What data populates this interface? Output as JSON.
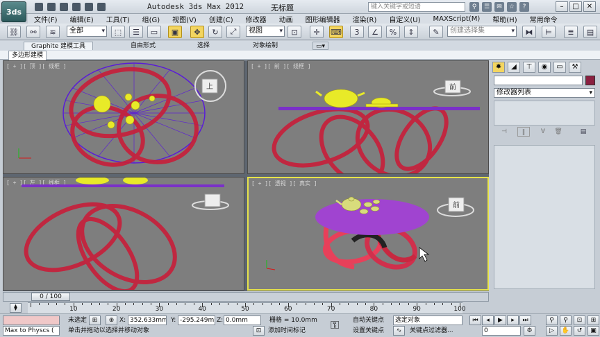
{
  "app": {
    "logo": "3ds",
    "title": "Autodesk 3ds Max  2012",
    "document": "无标题",
    "search_placeholder": "键入关键字或短语"
  },
  "menu": [
    "文件(F)",
    "编辑(E)",
    "工具(T)",
    "组(G)",
    "视图(V)",
    "创建(C)",
    "修改器",
    "动画",
    "图形编辑器",
    "渲染(R)",
    "自定义(U)",
    "MAXScript(M)",
    "帮助(H)",
    "常用命令"
  ],
  "toolbar": {
    "selection_filter": "全部",
    "ref_coord": "视图",
    "named_selection_placeholder": "创建选择集",
    "snap_labels": [
      "3",
      "%"
    ]
  },
  "ribbon": {
    "tabs": [
      "Graphite 建模工具",
      "自由形式",
      "选择",
      "对象绘制"
    ],
    "panel_label": "多边形建模"
  },
  "viewports": [
    {
      "label": "[ + ][ 顶 ][ 线框 ]",
      "cube": "上"
    },
    {
      "label": "[ + ][ 前 ][ 线框 ]",
      "cube": "前"
    },
    {
      "label": "[ + ][ 左 ][ 线框 ]",
      "cube": ""
    },
    {
      "label": "[ + ][ 透视 ][ 真实 ]",
      "cube": "前"
    }
  ],
  "command_panel": {
    "modifier_list": "修改器列表",
    "object_color": "#8a2040"
  },
  "time": {
    "slider": "0 / 100",
    "ruler": [
      0,
      10,
      20,
      30,
      40,
      50,
      60,
      70,
      80,
      90,
      100
    ],
    "labels_shown": [
      "10",
      "20",
      "30",
      "40",
      "50",
      "60",
      "70",
      "80",
      "90",
      "100"
    ]
  },
  "status": {
    "script_field": "Max to Physcs (",
    "selection": "未选定",
    "x_label": "X:",
    "x_value": "352.633mm",
    "y_label": "Y:",
    "y_value": "-295.249m",
    "z_label": "Z:",
    "z_value": "0.0mm",
    "grid": "栅格 = 10.0mm",
    "prompt": "单击并拖动以选择并移动对象",
    "add_time_tag": "添加时间标记",
    "auto_key": "自动关键点",
    "set_key": "设置关键点",
    "key_mode_dropdown": "选定对象",
    "key_filters": "关键点过滤器...",
    "frame": "0"
  },
  "colors": {
    "wire_red": "#c81e3a",
    "table_purple": "#a044d0",
    "teapot_yellow": "#e8ea28",
    "active_border": "#e7e34a"
  }
}
